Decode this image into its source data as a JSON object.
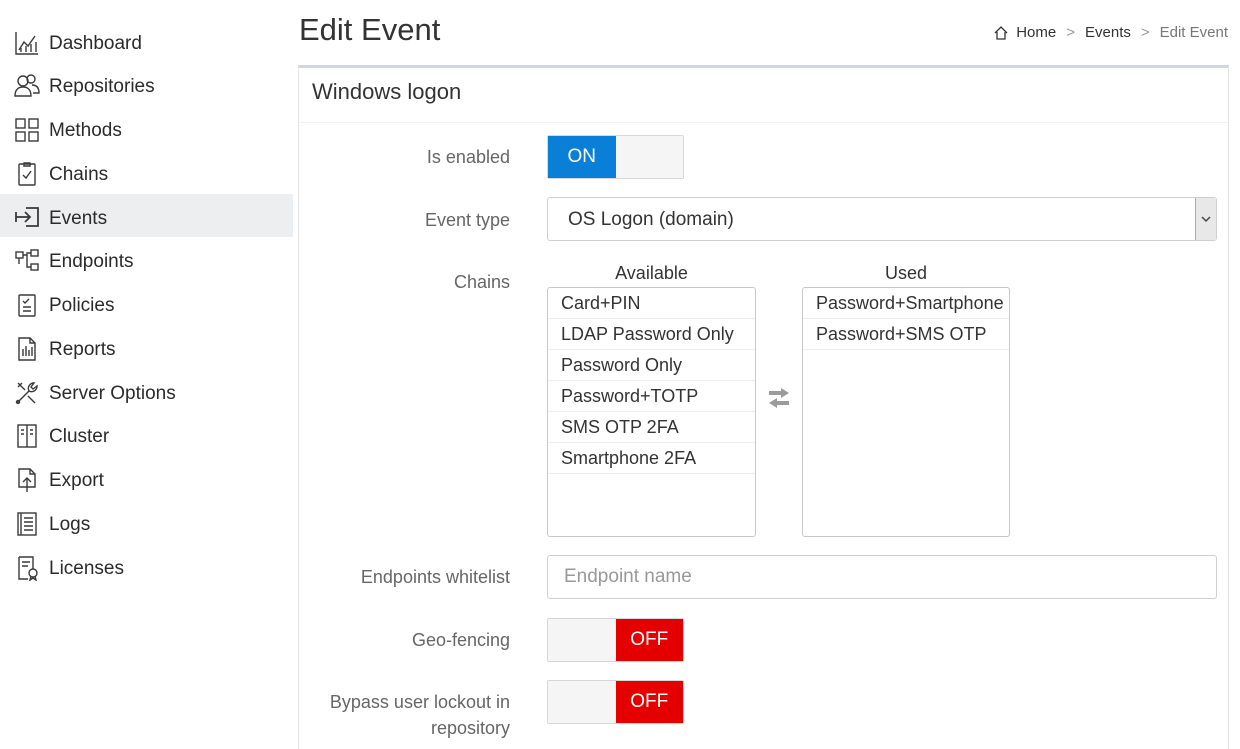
{
  "sidebar": {
    "items": [
      {
        "label": "Dashboard",
        "icon": "chart-icon"
      },
      {
        "label": "Repositories",
        "icon": "users-icon"
      },
      {
        "label": "Methods",
        "icon": "grid-icon"
      },
      {
        "label": "Chains",
        "icon": "clipboard-check-icon"
      },
      {
        "label": "Events",
        "icon": "sign-in-icon",
        "active": true
      },
      {
        "label": "Endpoints",
        "icon": "network-icon"
      },
      {
        "label": "Policies",
        "icon": "policy-icon"
      },
      {
        "label": "Reports",
        "icon": "report-icon"
      },
      {
        "label": "Server Options",
        "icon": "tools-icon"
      },
      {
        "label": "Cluster",
        "icon": "cluster-icon"
      },
      {
        "label": "Export",
        "icon": "export-icon"
      },
      {
        "label": "Logs",
        "icon": "logs-icon"
      },
      {
        "label": "Licenses",
        "icon": "license-icon"
      }
    ]
  },
  "header": {
    "title": "Edit Event",
    "breadcrumb": {
      "home": "Home",
      "events": "Events",
      "current": "Edit Event",
      "separator": ">"
    }
  },
  "panel": {
    "title": "Windows logon",
    "is_enabled": {
      "label": "Is enabled",
      "value": "ON"
    },
    "event_type": {
      "label": "Event type",
      "value": "OS Logon (domain)"
    },
    "chains": {
      "label": "Chains",
      "available_header": "Available",
      "used_header": "Used",
      "available": [
        "Card+PIN",
        "LDAP Password Only",
        "Password Only",
        "Password+TOTP",
        "SMS OTP 2FA",
        "Smartphone 2FA"
      ],
      "used": [
        "Password+Smartphone",
        "Password+SMS OTP"
      ]
    },
    "endpoints_whitelist": {
      "label": "Endpoints whitelist",
      "placeholder": "Endpoint name"
    },
    "geo_fencing": {
      "label": "Geo-fencing",
      "value": "OFF"
    },
    "bypass_lockout": {
      "label_line1": "Bypass user lockout in",
      "label_line2": "repository",
      "value": "OFF"
    }
  },
  "colors": {
    "on": "#0a7fd8",
    "off": "#e50000",
    "active_nav": "#eceeef"
  }
}
